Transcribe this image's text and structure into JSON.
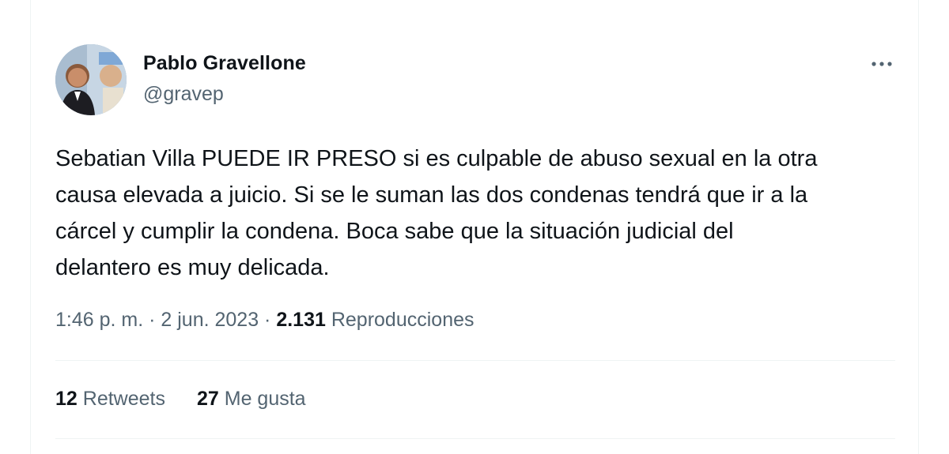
{
  "author": {
    "display_name": "Pablo Gravellone",
    "handle": "@gravep"
  },
  "icons": {
    "more": "more-horizontal-icon",
    "avatar": "profile-photo"
  },
  "tweet": {
    "text": "Sebatian Villa PUEDE IR PRESO si es culpable de abuso sexual en la otra\ncausa elevada a juicio. Si se le suman las dos condenas tendrá que ir a la\ncárcel y cumplir la condena. Boca sabe que la situación judicial del\ndelantero es muy delicada."
  },
  "meta": {
    "time": "1:46 p. m.",
    "separator": " · ",
    "date": "2 jun. 2023",
    "views_count": "2.131",
    "views_label": "Reproducciones"
  },
  "stats": {
    "retweets_count": "12",
    "retweets_label": "Retweets",
    "likes_count": "27",
    "likes_label": "Me gusta"
  },
  "colors": {
    "text_primary": "#0f1419",
    "text_secondary": "#536471",
    "divider": "#eff3f4"
  }
}
